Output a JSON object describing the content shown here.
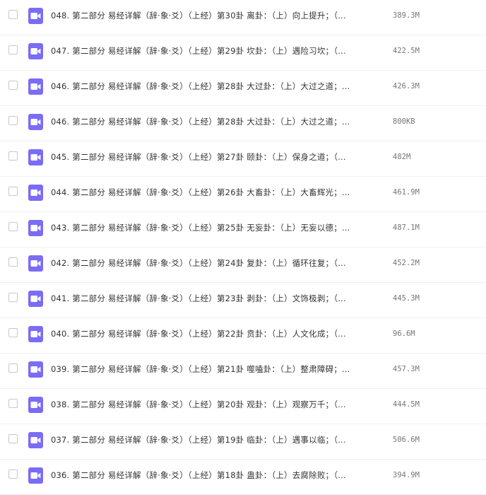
{
  "icon_color": "#7b6cf6",
  "icon_name": "video-file-icon",
  "files": [
    {
      "name": "048. 第二部分 易经详解（辞·象·爻）（上经）第30卦 离卦：（上）向上提升；（…",
      "size": "389.3M"
    },
    {
      "name": "047. 第二部分 易经详解（辞·象·爻）（上经）第29卦 坎卦：（上）遇险习坎；（…",
      "size": "422.5M"
    },
    {
      "name": "046. 第二部分 易经详解（辞·象·爻）（上经）第28卦 大过卦：（上）大过之道；…",
      "size": "426.3M"
    },
    {
      "name": "046. 第二部分 易经详解（辞·象·爻）（上经）第28卦 大过卦：（上）大过之道；…",
      "size": "800KB"
    },
    {
      "name": "045. 第二部分 易经详解（辞·象·爻）（上经）第27卦 颐卦：（上）保身之道；（…",
      "size": "482M"
    },
    {
      "name": "044. 第二部分 易经详解（辞·象·爻）（上经）第26卦 大畜卦：（上）大畜辉光；…",
      "size": "461.9M"
    },
    {
      "name": "043. 第二部分 易经详解（辞·象·爻）（上经）第25卦 无妄卦：（上）无妄以德；…",
      "size": "487.1M"
    },
    {
      "name": "042. 第二部分 易经详解（辞·象·爻）（上经）第24卦 复卦：（上）循环往复；（…",
      "size": "452.2M"
    },
    {
      "name": "041. 第二部分 易经详解（辞·象·爻）（上经）第23卦 剥卦：（上）文饰极剥；（…",
      "size": "445.3M"
    },
    {
      "name": "040. 第二部分 易经详解（辞·象·爻）（上经）第22卦 贲卦：（上）人文化成；（…",
      "size": "96.6M"
    },
    {
      "name": "039. 第二部分 易经详解（辞·象·爻）（上经）第21卦 噬嗑卦：（上）整肃障碍；…",
      "size": "457.3M"
    },
    {
      "name": "038. 第二部分 易经详解（辞·象·爻）（上经）第20卦 观卦：（上）观察万千；（…",
      "size": "444.5M"
    },
    {
      "name": "037. 第二部分 易经详解（辞·象·爻）（上经）第19卦 临卦：（上）遇事以临；（…",
      "size": "506.6M"
    },
    {
      "name": "036. 第二部分 易经详解（辞·象·爻）（上经）第18卦 蛊卦：（上）去腐除败；（…",
      "size": "394.9M"
    }
  ]
}
